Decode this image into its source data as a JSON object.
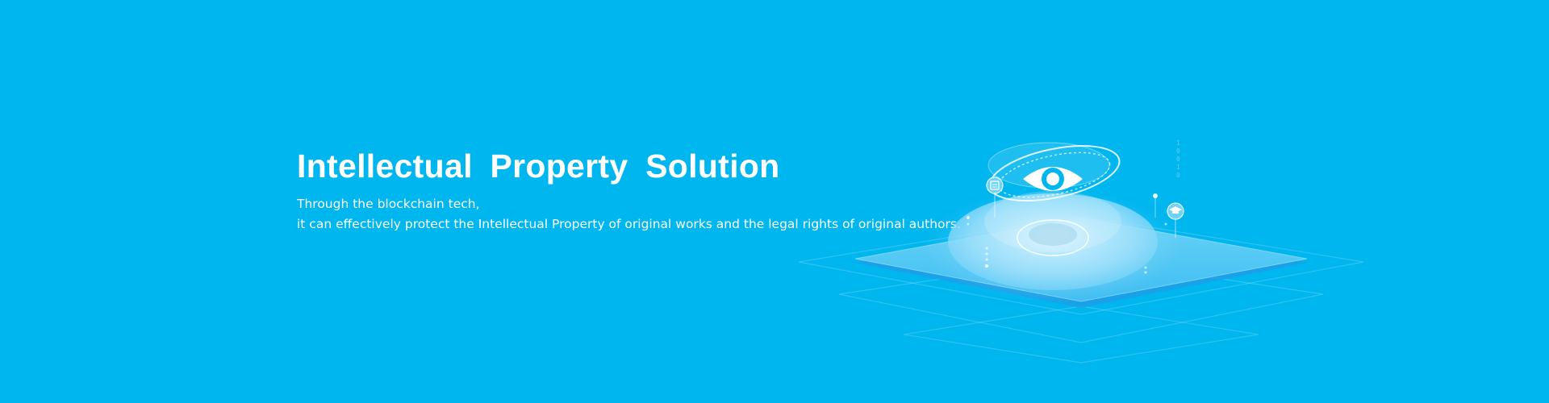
{
  "hero": {
    "title": "Intellectual  Property  Solution",
    "subtitle_line1": "Through the blockchain tech,",
    "subtitle_line2": "it can effectively protect the Intellectual Property of original works and the legal rights of original authors."
  },
  "illustration": {
    "icon": "eye-icon",
    "side_icons": [
      "document-icon",
      "graduation-cap-icon"
    ]
  },
  "colors": {
    "background": "#00b6ef",
    "text": "#ffffff",
    "platform": "#4fcaf5",
    "platform_edge": "#1e9fe8"
  }
}
